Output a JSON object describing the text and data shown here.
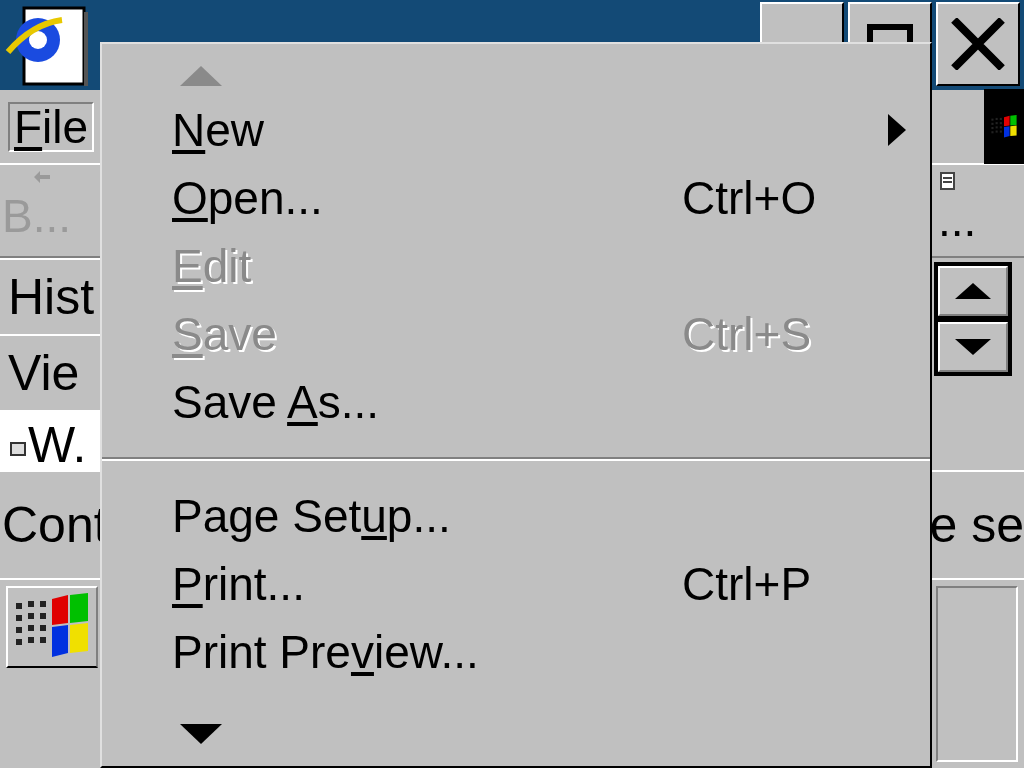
{
  "menu_bar": {
    "items": [
      {
        "key": "F",
        "after": "ile",
        "selected": true
      }
    ]
  },
  "toolbar": {
    "back": {
      "label": "B...",
      "disabled": true
    },
    "right_label": "..."
  },
  "side_rows": [
    {
      "kind": "button",
      "after": "Hist"
    },
    {
      "kind": "button",
      "after": "Vie"
    },
    {
      "kind": "address",
      "after": "W."
    }
  ],
  "status_bar": {
    "left": "Cont",
    "right": "e se"
  },
  "file_menu": {
    "scroll_up": {
      "disabled": true
    },
    "scroll_down": {
      "disabled": false
    },
    "items": [
      {
        "kind": "item",
        "key": "N",
        "after": "ew",
        "disabled": false,
        "submenu": true
      },
      {
        "kind": "item",
        "key": "O",
        "after": "pen...",
        "disabled": false,
        "submenu": false,
        "shortcut": "Ctrl+O"
      },
      {
        "kind": "item",
        "key": "E",
        "after": "dit",
        "disabled": true,
        "submenu": false
      },
      {
        "kind": "item",
        "key": "S",
        "after": "ave",
        "disabled": true,
        "submenu": false,
        "shortcut": "Ctrl+S"
      },
      {
        "kind": "item",
        "before": "Save ",
        "key": "A",
        "after": "s...",
        "disabled": false,
        "submenu": false
      },
      {
        "kind": "separator"
      },
      {
        "kind": "item",
        "before": "Page Set",
        "key": "u",
        "after": "p...",
        "disabled": false,
        "submenu": false
      },
      {
        "kind": "item",
        "key": "P",
        "after": "rint...",
        "disabled": false,
        "submenu": false,
        "shortcut": "Ctrl+P"
      },
      {
        "kind": "item",
        "before": "Print Pre",
        "key": "v",
        "after": "iew...",
        "disabled": false,
        "submenu": false
      }
    ]
  }
}
